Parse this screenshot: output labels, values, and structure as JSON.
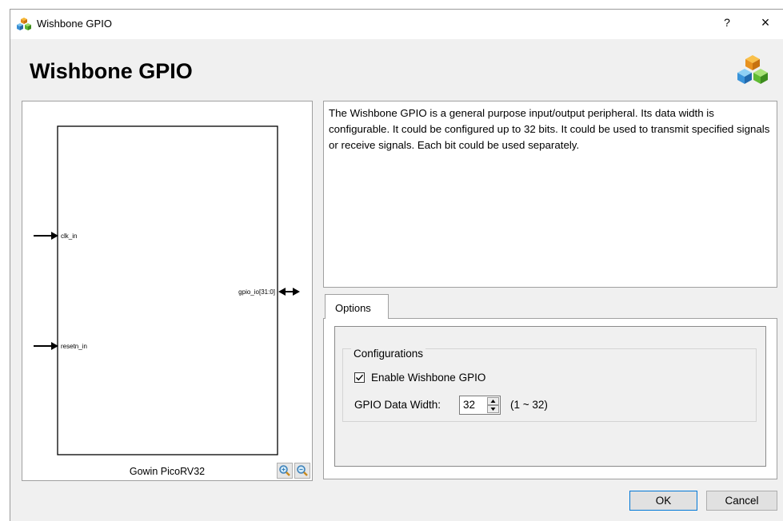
{
  "window": {
    "title": "Wishbone GPIO",
    "help_label": "?",
    "close_label": "×"
  },
  "header": {
    "title": "Wishbone GPIO"
  },
  "diagram": {
    "block_name": "Gowin PicoRV32",
    "ports": {
      "clk": "clk_in",
      "reset": "resetn_in",
      "gpio": "gpio_io[31:0]"
    }
  },
  "description": "The Wishbone GPIO is a general purpose input/output peripheral. Its data width is configurable. It could be configured up to 32 bits. It could be used to transmit specified signals or receive signals. Each bit could be used separately.",
  "options": {
    "tab_label": "Options",
    "group_title": "Configurations",
    "enable_label": "Enable Wishbone GPIO",
    "enable_checked": true,
    "width_label": "GPIO Data Width:",
    "width_value": "32",
    "width_range": "(1 ~ 32)"
  },
  "buttons": {
    "ok": "OK",
    "cancel": "Cancel"
  },
  "colors": {
    "accent": "#0078d7",
    "window_bg": "#f0f0f0"
  }
}
